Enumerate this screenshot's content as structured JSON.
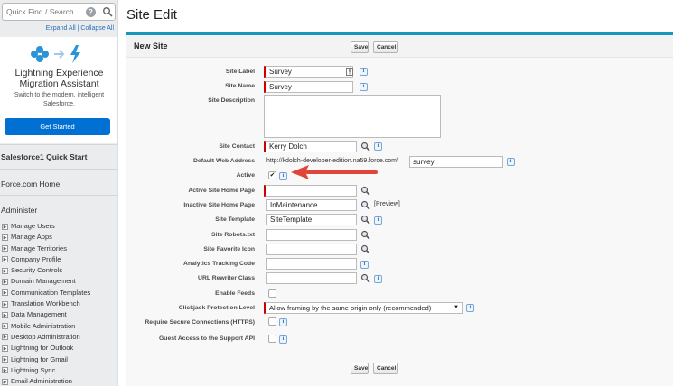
{
  "sidebar": {
    "search_placeholder": "Quick Find / Search...",
    "search_help": "?",
    "expand_all": "Expand All",
    "separator": " | ",
    "collapse_all": "Collapse All",
    "le_title_line1": "Lightning Experience",
    "le_title_line2": "Migration Assistant",
    "le_sub": "Switch to the modern, intelligent Salesforce.",
    "get_started": "Get Started",
    "quick_start": "Salesforce1 Quick Start",
    "forcecom_home": "Force.com Home",
    "administer": "Administer",
    "admin_items": [
      "Manage Users",
      "Manage Apps",
      "Manage Territories",
      "Company Profile",
      "Security Controls",
      "Domain Management",
      "Communication Templates",
      "Translation Workbench",
      "Data Management",
      "Mobile Administration",
      "Desktop Administration",
      "Lightning for Outlook",
      "Lightning for Gmail",
      "Lightning Sync",
      "Email Administration"
    ]
  },
  "page_title": "Site Edit",
  "panel": {
    "title": "New Site",
    "save": "Save",
    "cancel": "Cancel"
  },
  "form": {
    "site_label": {
      "label": "Site Label",
      "value": "Survey"
    },
    "site_name": {
      "label": "Site Name",
      "value": "Survey"
    },
    "site_description": {
      "label": "Site Description",
      "value": ""
    },
    "site_contact": {
      "label": "Site Contact",
      "value": "Kerry Dolch"
    },
    "default_web_address": {
      "label": "Default Web Address",
      "prefix": "http://kdolch-developer-edition.na59.force.com/",
      "value": "survey"
    },
    "active": {
      "label": "Active",
      "checked": "✔"
    },
    "active_home_page": {
      "label": "Active Site Home Page",
      "value": ""
    },
    "inactive_home_page": {
      "label": "Inactive Site Home Page",
      "value": "InMaintenance",
      "preview": "[Preview]"
    },
    "site_template": {
      "label": "Site Template",
      "value": "SiteTemplate"
    },
    "site_robots": {
      "label": "Site Robots.txt",
      "value": ""
    },
    "site_favorite_icon": {
      "label": "Site Favorite Icon",
      "value": ""
    },
    "analytics_code": {
      "label": "Analytics Tracking Code",
      "value": ""
    },
    "url_rewriter": {
      "label": "URL Rewriter Class",
      "value": ""
    },
    "enable_feeds": {
      "label": "Enable Feeds"
    },
    "clickjack": {
      "label": "Clickjack Protection Level",
      "value": "Allow framing by the same origin only (recommended)"
    },
    "require_https": {
      "label": "Require Secure Connections (HTTPS)"
    },
    "guest_access": {
      "label": "Guest Access to the Support API"
    },
    "info_glyph": "i"
  },
  "colors": {
    "accent": "#1797c0",
    "brand_button": "#0070d2",
    "required": "#cc0000",
    "arrow": "#e0453a"
  }
}
